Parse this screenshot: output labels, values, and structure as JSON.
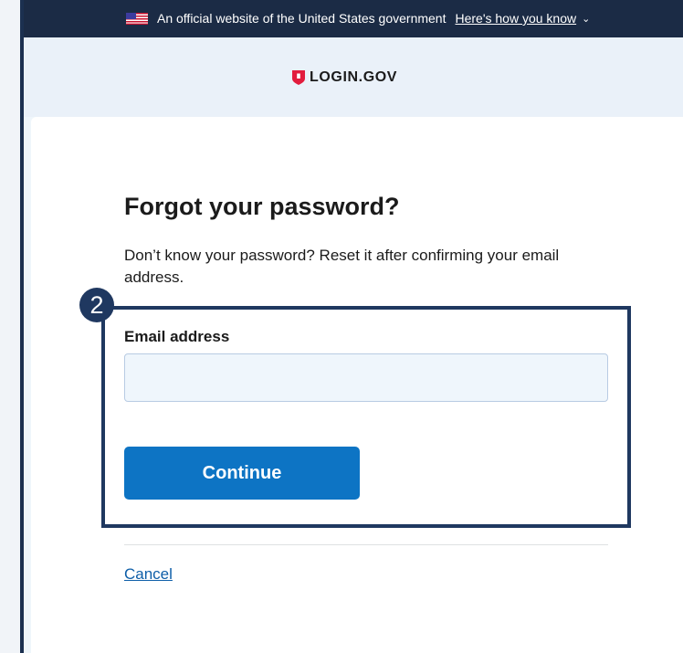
{
  "gov_banner": {
    "text": "An official website of the United States government",
    "link_text": "Here's how you know",
    "chevron": "⌄"
  },
  "header": {
    "logo_text": "LOGIN.GOV",
    "logo_icon": "shield-icon"
  },
  "form": {
    "title": "Forgot your password?",
    "description": "Don’t know your password? Reset it after confirming your email address.",
    "email_label": "Email address",
    "email_value": "",
    "email_placeholder": "",
    "continue_label": "Continue",
    "cancel_label": "Cancel"
  },
  "annotation": {
    "step_number": "2"
  },
  "colors": {
    "banner_bg": "#1b2b45",
    "header_bg": "#eaf1f9",
    "primary_button": "#0d74c4",
    "link": "#0d5ea8",
    "highlight_border": "#1f3860",
    "input_bg": "#eff6fc",
    "brand_red": "#e21c3d"
  }
}
